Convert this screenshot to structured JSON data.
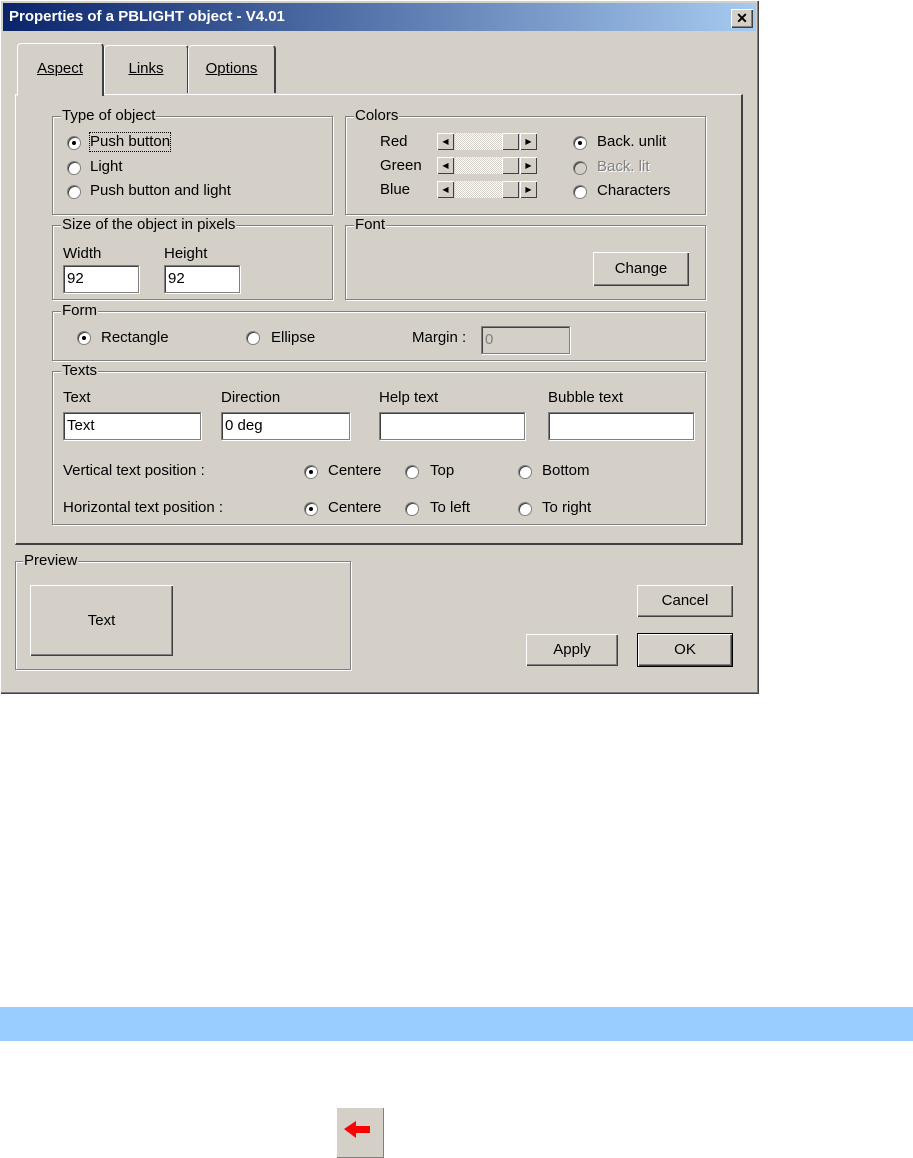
{
  "window": {
    "title": "Properties of a PBLIGHT object - V4.01",
    "close": "✕"
  },
  "tabs": [
    {
      "label": "Aspect"
    },
    {
      "label": "Links"
    },
    {
      "label": "Options"
    }
  ],
  "type_of_object": {
    "legend": "Type of object",
    "options": [
      {
        "label": "Push button",
        "selected": true
      },
      {
        "label": "Light",
        "selected": false
      },
      {
        "label": "Push button and light",
        "selected": false
      }
    ]
  },
  "colors": {
    "legend": "Colors",
    "sliders": [
      {
        "label": "Red"
      },
      {
        "label": "Green"
      },
      {
        "label": "Blue"
      }
    ],
    "targets": [
      {
        "label": "Back. unlit",
        "selected": true,
        "enabled": true
      },
      {
        "label": "Back. lit",
        "selected": false,
        "enabled": false
      },
      {
        "label": "Characters",
        "selected": false,
        "enabled": true
      }
    ]
  },
  "size": {
    "legend": "Size of the object in pixels",
    "width_label": "Width",
    "width_value": "92",
    "height_label": "Height",
    "height_value": "92"
  },
  "font": {
    "legend": "Font",
    "change_label": "Change"
  },
  "form": {
    "legend": "Form",
    "rectangle": "Rectangle",
    "ellipse": "Ellipse",
    "selected": "Rectangle",
    "margin_label": "Margin :",
    "margin_value": "0"
  },
  "texts": {
    "legend": "Texts",
    "text_label": "Text",
    "text_value": "Text",
    "direction_label": "Direction",
    "direction_value": "0 deg",
    "help_label": "Help text",
    "help_value": "",
    "bubble_label": "Bubble text",
    "bubble_value": "",
    "vertical_label": "Vertical text position :",
    "vertical_options": [
      "Centere",
      "Top",
      "Bottom"
    ],
    "horizontal_label": "Horizontal text position :",
    "horizontal_options": [
      "Centere",
      "To left",
      "To right"
    ]
  },
  "preview": {
    "legend": "Preview",
    "button_text": "Text"
  },
  "buttons": {
    "cancel": "Cancel",
    "apply": "Apply",
    "ok": "OK"
  },
  "colors_theme": {
    "band": "#99ccff",
    "dialog_bg": "#d4d0c8",
    "title_start": "#0a246a",
    "arrow": "#ff0000"
  },
  "icons": {
    "back": "red-left-arrow-icon"
  }
}
